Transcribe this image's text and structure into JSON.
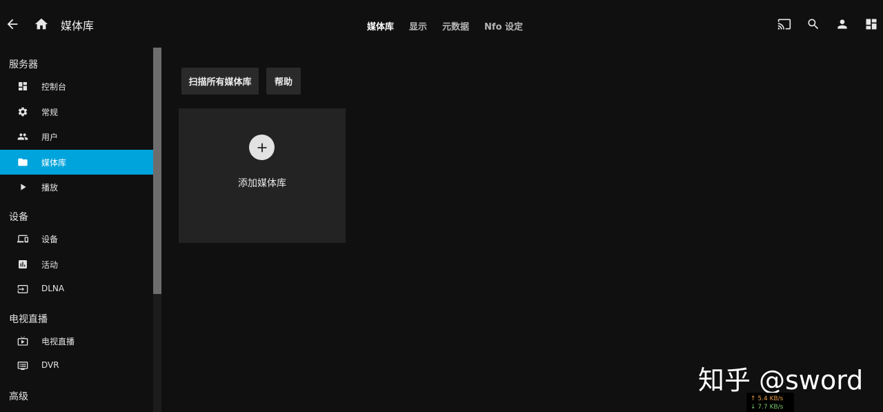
{
  "header": {
    "title": "媒体库",
    "tabs": [
      {
        "label": "媒体库",
        "active": true
      },
      {
        "label": "显示",
        "active": false
      },
      {
        "label": "元数据",
        "active": false
      },
      {
        "label": "Nfo 设定",
        "active": false
      }
    ],
    "icons": [
      "arrow-back-icon",
      "home-icon",
      "cast-icon",
      "search-icon",
      "user-icon",
      "dashboard-icon"
    ]
  },
  "sidebar": {
    "sections": [
      {
        "title": "服务器",
        "items": [
          {
            "label": "控制台",
            "icon": "dashboard-icon"
          },
          {
            "label": "常规",
            "icon": "gear-icon"
          },
          {
            "label": "用户",
            "icon": "people-icon"
          },
          {
            "label": "媒体库",
            "icon": "folder-icon",
            "active": true
          },
          {
            "label": "播放",
            "icon": "play-icon"
          }
        ]
      },
      {
        "title": "设备",
        "items": [
          {
            "label": "设备",
            "icon": "devices-icon"
          },
          {
            "label": "活动",
            "icon": "chart-icon"
          },
          {
            "label": "DLNA",
            "icon": "input-icon"
          }
        ]
      },
      {
        "title": "电视直播",
        "items": [
          {
            "label": "电视直播",
            "icon": "live-tv-icon"
          },
          {
            "label": "DVR",
            "icon": "dvr-icon"
          }
        ]
      },
      {
        "title": "高级",
        "items": []
      }
    ]
  },
  "main": {
    "scan_button": "扫描所有媒体库",
    "help_button": "帮助",
    "add_library_label": "添加媒体库"
  },
  "overlay": {
    "watermark": "知乎 @sword",
    "upload_speed": "↑ 5.4 KB/s",
    "download_speed": "↓ 7.7 KB/s"
  },
  "colors": {
    "accent": "#00a4dc",
    "background": "#101010",
    "card": "#232323",
    "button": "#2a2a2a"
  }
}
